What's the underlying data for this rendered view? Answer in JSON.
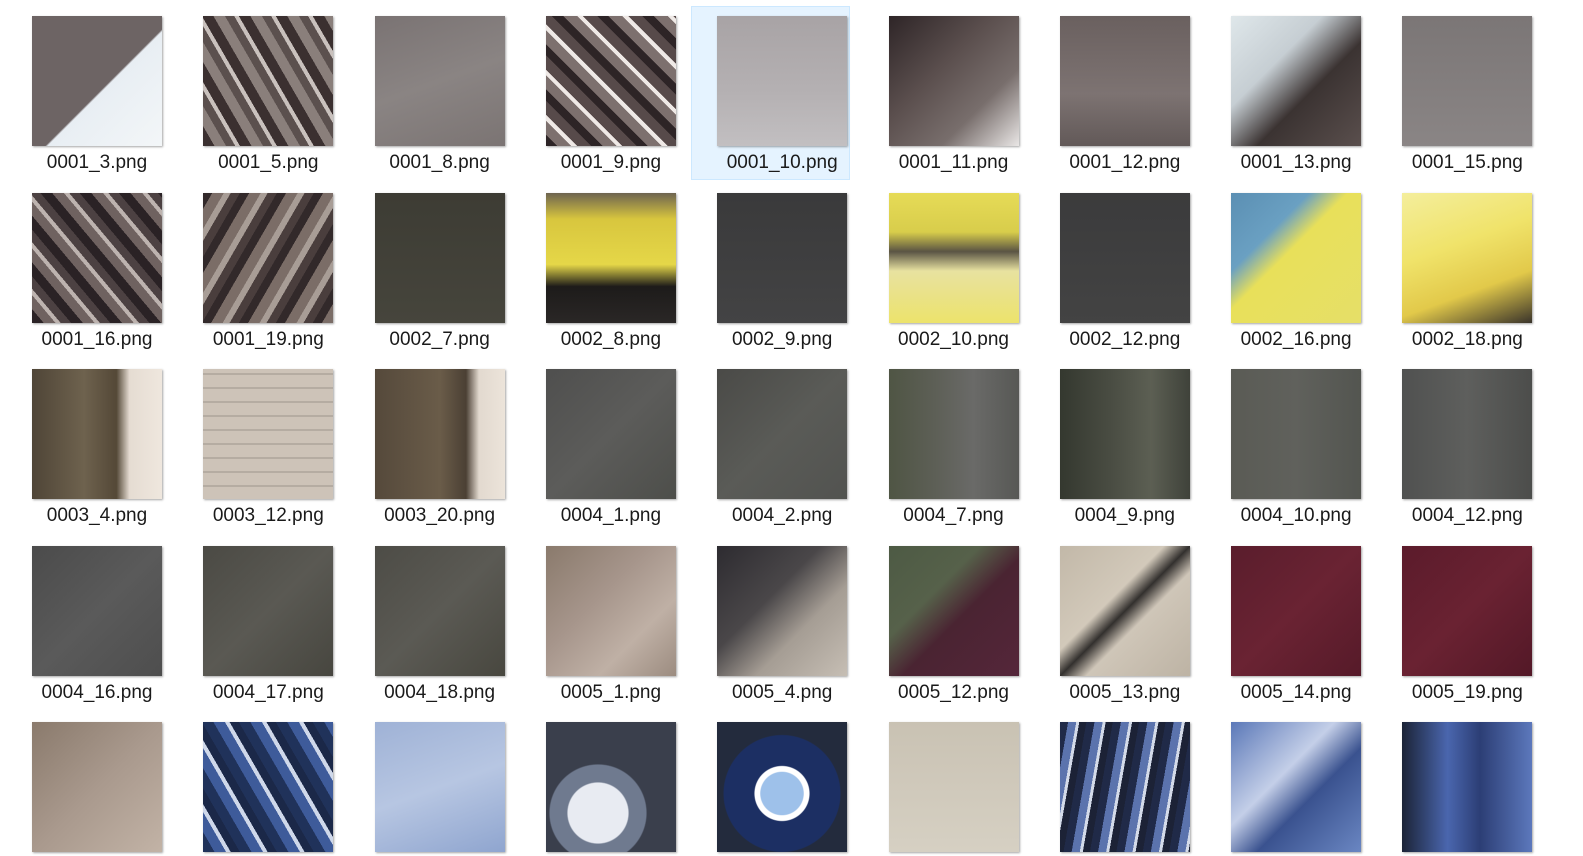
{
  "files": [
    {
      "name": "0001_3.png",
      "bg": "linear-gradient(135deg,#6d6464 0%,#6d6464 55%,#e8eef3 56%,#f3f6f8 100%)"
    },
    {
      "name": "0001_5.png",
      "bg": "repeating-linear-gradient(60deg,#3b3030 0 10px,#8a7f7b 10px 20px,#5b504e 20px 28px,#c9c1bd 28px 32px)"
    },
    {
      "name": "0001_8.png",
      "bg": "linear-gradient(160deg,#7a7373 0%,#8a8483 50%,#7b7473 100%)"
    },
    {
      "name": "0001_9.png",
      "bg": "repeating-linear-gradient(45deg,#2d2426 0 8px,#7d706e 8px 18px,#efe9e6 18px 22px,#574a4a 22px 32px)"
    },
    {
      "name": "0001_10.png",
      "bg": "linear-gradient(180deg,#a8a3a5 0%,#b5b1b3 60%,#c2bfc1 100%)",
      "selected": true
    },
    {
      "name": "0001_11.png",
      "bg": "linear-gradient(135deg,#2e2527 0%,#5b4f4e 40%,#786e6c 70%,#e9e6e5 100%)"
    },
    {
      "name": "0001_12.png",
      "bg": "linear-gradient(180deg,#6a605f 0%,#7d7372 60%,#625958 100%)"
    },
    {
      "name": "0001_13.png",
      "bg": "linear-gradient(135deg,#dfe7ea 0%,#c6ced3 35%,#3b3332 60%,#5a4f4d 100%)"
    },
    {
      "name": "0001_15.png",
      "bg": "linear-gradient(180deg,#7b7676 0%,#8a8585 100%)"
    },
    {
      "name": "0001_16.png",
      "bg": "repeating-linear-gradient(50deg,#2a2225 0 9px,#6f6260 9px 18px,#bdb3af 18px 22px,#4c4142 22px 30px)"
    },
    {
      "name": "0001_19.png",
      "bg": "repeating-linear-gradient(120deg,#32292a 0 8px,#7b6d67 8px 18px,#a89d96 18px 24px,#4a3e3d 24px 32px)"
    },
    {
      "name": "0002_7.png",
      "bg": "linear-gradient(180deg,#3d3c34 0%,#46453c 100%)"
    },
    {
      "name": "0002_8.png",
      "bg": "linear-gradient(180deg,#6e6450 0%,#d8c63e 20%,#e5d748 55%,#1d1b1a 72%,#2a2726 100%)"
    },
    {
      "name": "0002_9.png",
      "bg": "linear-gradient(180deg,#3a3a3b 0%,#434344 100%)"
    },
    {
      "name": "0002_10.png",
      "bg": "linear-gradient(180deg,#e6db57 0%,#d8cd4b 30%,#5a5444 45%,#e8e2a0 60%,#ece36c 100%)"
    },
    {
      "name": "0002_12.png",
      "bg": "linear-gradient(180deg,#3b3b3c 0%,#434343 100%)"
    },
    {
      "name": "0002_16.png",
      "bg": "linear-gradient(135deg,#5b8fb3 0%,#6aa0c2 30%,#e8e05a 45%,#e6df68 100%)"
    },
    {
      "name": "0002_18.png",
      "bg": "linear-gradient(160deg,#f4ee9c 0%,#f0e36a 40%,#e2c94a 70%,#3a342b 100%)"
    },
    {
      "name": "0003_4.png",
      "bg": "linear-gradient(90deg,#4f4537 0%,#6e624e 40%,#544837 65%,#e5dcd2 75%,#efe7de 100%)"
    },
    {
      "name": "0003_12.png",
      "bg": "repeating-linear-gradient(0deg,#cdc3b8 0 12px,#b5aca2 12px 14px)"
    },
    {
      "name": "0003_20.png",
      "bg": "linear-gradient(90deg,#55493b 0%,#6a5c49 50%,#4b4034 70%,#e2d9cf 80%,#ece4da 100%)"
    },
    {
      "name": "0004_1.png",
      "bg": "linear-gradient(135deg,#4f4f4e 0%,#5c5c5a 50%,#4d4e4a 100%)"
    },
    {
      "name": "0004_2.png",
      "bg": "linear-gradient(135deg,#4a4a47 0%,#5a5b57 50%,#525350 100%)"
    },
    {
      "name": "0004_7.png",
      "bg": "linear-gradient(90deg,#4f5544 0%,#5d5f56 35%,#6a6a68 65%,#575855 100%)"
    },
    {
      "name": "0004_9.png",
      "bg": "linear-gradient(90deg,#34382f 0%,#4a4d43 40%,#5c5f53 70%,#3f423a 100%)"
    },
    {
      "name": "0004_10.png",
      "bg": "linear-gradient(90deg,#5a5b55 0%,#60615c 50%,#535550 100%)"
    },
    {
      "name": "0004_12.png",
      "bg": "linear-gradient(90deg,#505150 0%,#5e5f5d 50%,#4c4d4b 100%)"
    },
    {
      "name": "0004_16.png",
      "bg": "linear-gradient(135deg,#4b4b4b 0%,#5a5a5a 50%,#4e4e4e 100%)"
    },
    {
      "name": "0004_17.png",
      "bg": "linear-gradient(135deg,#4b4a44 0%,#5a5953 50%,#47463f 100%)"
    },
    {
      "name": "0004_18.png",
      "bg": "linear-gradient(135deg,#4d4c46 0%,#5b5a54 50%,#48473f 100%)"
    },
    {
      "name": "0005_1.png",
      "bg": "linear-gradient(135deg,#8a7a6c 0%,#a6958b 40%,#bfb0a5 70%,#9c8c80 100%)"
    },
    {
      "name": "0005_4.png",
      "bg": "linear-gradient(135deg,#2d2b30 0%,#4a4749 40%,#a59d94 65%,#c6beb4 100%)"
    },
    {
      "name": "0005_12.png",
      "bg": "linear-gradient(135deg,#4d5a44 0%,#56614a 35%,#4a2432 55%,#55263a 100%)"
    },
    {
      "name": "0005_13.png",
      "bg": "linear-gradient(135deg,#c2b8a8 0%,#d2c9ba 40%,#33302e 50%,#cfc6b8 60%,#bdb3a4 100%)"
    },
    {
      "name": "0005_14.png",
      "bg": "linear-gradient(135deg,#5a1d2c 0%,#6a2333 50%,#561a29 100%)"
    },
    {
      "name": "0005_19.png",
      "bg": "linear-gradient(135deg,#5b1b2b 0%,#6a2232 50%,#531827 100%)"
    },
    {
      "name": "",
      "bg": "linear-gradient(135deg,#8a7a6c 0%,#a9998d 50%,#c2b3a6 100%)"
    },
    {
      "name": "",
      "bg": "repeating-linear-gradient(60deg,#20325a 0 10px,#3e5b9a 10px 20px,#cfd8ea 20px 24px,#1b2848 24px 32px)"
    },
    {
      "name": "",
      "bg": "linear-gradient(160deg,#9fb2d6 0%,#b7c6e2 50%,#8fa5cf 100%)"
    },
    {
      "name": "",
      "bg": "radial-gradient(circle at 40% 70%,#e8ebf2 0 25%,#6f7a8f 26% 40%,#3a3f4c 41% 100%)"
    },
    {
      "name": "",
      "bg": "radial-gradient(circle at 50% 55%,#9ec1ea 0 22%,#ffffff 23% 28%,#1c2f63 29% 60%,#232b3d 61% 100%)"
    },
    {
      "name": "",
      "bg": "linear-gradient(180deg,#c9c2b3 0%,#d6d0c3 100%)"
    },
    {
      "name": "",
      "bg": "repeating-linear-gradient(100deg,#202a48 0 8px,#5b73ad 8px 16px,#d4dbe9 16px 19px,#1c2236 19px 26px)"
    },
    {
      "name": "",
      "bg": "linear-gradient(135deg,#5b78b8 0%,#c4cfe8 40%,#3a528f 60%,#6a86c2 100%)"
    },
    {
      "name": "",
      "bg": "linear-gradient(90deg,#1b2336 0%,#4a66ae 35%,#2c3e75 60%,#5c78bc 100%)"
    }
  ],
  "grid": {
    "columns": 9,
    "selected_label": "0001_10.png"
  }
}
